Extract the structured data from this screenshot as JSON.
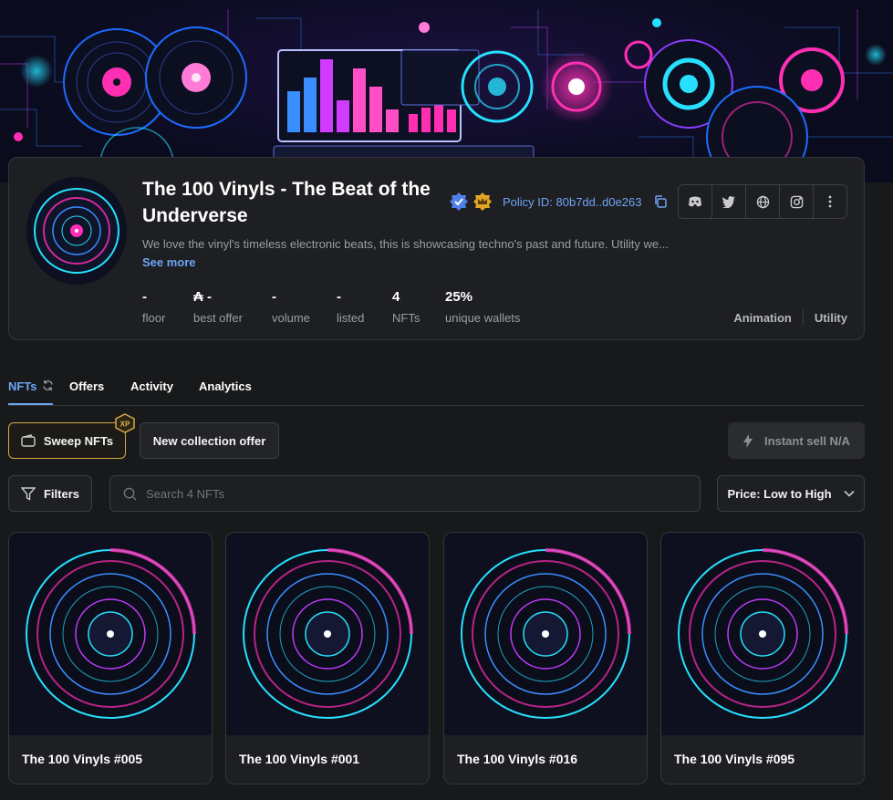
{
  "collection": {
    "title": "The 100 Vinyls - The Beat of the Underverse",
    "policy_id": "Policy ID: 80b7dd..d0e263",
    "description": "We love the vinyl's timeless electronic beats, this is showcasing techno's past and future. Utility we...",
    "see_more": "See more",
    "stats": [
      {
        "value": "-",
        "label": "floor"
      },
      {
        "value": "₳ -",
        "label": "best offer"
      },
      {
        "value": "-",
        "label": "volume"
      },
      {
        "value": "-",
        "label": "listed"
      },
      {
        "value": "4",
        "label": "NFTs"
      },
      {
        "value": "25%",
        "label": "unique wallets"
      }
    ],
    "tags": [
      "Animation",
      "Utility"
    ],
    "socials": [
      "discord-icon",
      "twitter-icon",
      "globe-icon",
      "instagram-icon",
      "more-icon"
    ]
  },
  "tabs": [
    "NFTs",
    "Offers",
    "Activity",
    "Analytics"
  ],
  "actions": {
    "sweep": "Sweep NFTs",
    "xp_badge": "XP",
    "new_offer": "New collection offer",
    "instant_sell": "Instant sell N/A",
    "filters": "Filters",
    "search_placeholder": "Search 4 NFTs",
    "sort": "Price: Low to High"
  },
  "nfts": [
    {
      "name": "The 100 Vinyls #005"
    },
    {
      "name": "The 100 Vinyls #001"
    },
    {
      "name": "The 100 Vinyls #016"
    },
    {
      "name": "The 100 Vinyls #095"
    }
  ],
  "colors": {
    "accent": "#6da5f5",
    "gold": "#d4a847",
    "neon_pink": "#ff2fb4",
    "neon_cyan": "#27e0ff"
  }
}
